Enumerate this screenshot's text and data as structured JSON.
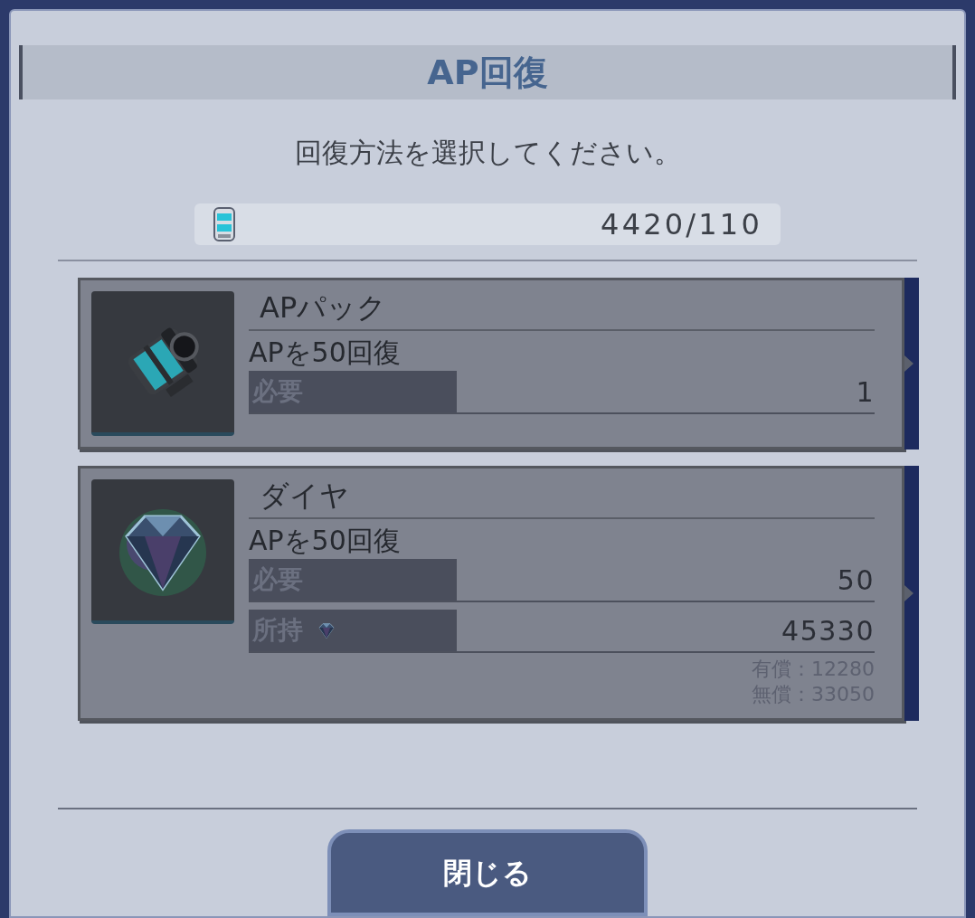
{
  "dialog": {
    "title": "AP回復",
    "instruction": "回復方法を選択してください。",
    "ap_display": "4420/110",
    "options": [
      {
        "kind": "pack",
        "name": "APパック",
        "effect": "APを50回復",
        "rows": [
          {
            "kind": "plain",
            "label": "必要",
            "value": "1"
          }
        ]
      },
      {
        "kind": "diamond",
        "name": "ダイヤ",
        "effect": "APを50回復",
        "rows": [
          {
            "kind": "plain",
            "label": "必要",
            "value": "50"
          },
          {
            "kind": "currency",
            "label": "所持",
            "value": "45330"
          }
        ],
        "notes": [
          "有償：12280",
          "無償：33050"
        ]
      }
    ],
    "close_button": "閉じる"
  }
}
